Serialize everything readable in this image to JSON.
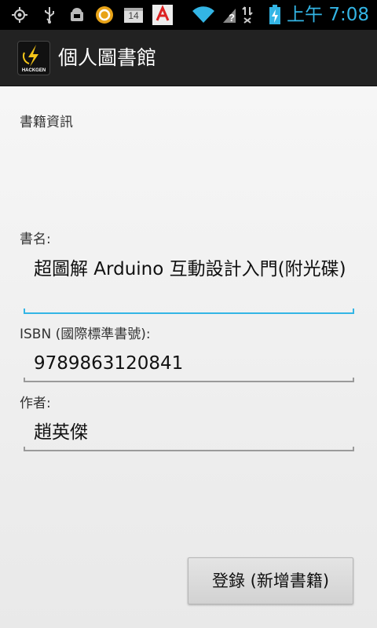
{
  "status_bar": {
    "time": "上午 7:08",
    "notification_count": "14",
    "icons": [
      "gps-icon",
      "usb-icon",
      "android-debug-icon",
      "sync-app-icon",
      "calendar-icon",
      "app-notification-icon",
      "wifi-icon",
      "no-signal-icon",
      "data-off-icon",
      "battery-charging-icon"
    ],
    "colors": {
      "time": "#33b5e5",
      "wifi": "#33b5e5",
      "battery": "#33b5e5"
    }
  },
  "action_bar": {
    "title": "個人圖書館",
    "logo_text": "HACKGEN"
  },
  "form": {
    "section_header": "書籍資訊",
    "title_label": "書名:",
    "title_value": "超圖解 Arduino 互動設計入門(附光碟)",
    "isbn_label": "ISBN (國際標準書號):",
    "isbn_value": "9789863120841",
    "author_label": "作者:",
    "author_value": "趙英傑",
    "submit_label": "登錄 (新增書籍)"
  }
}
